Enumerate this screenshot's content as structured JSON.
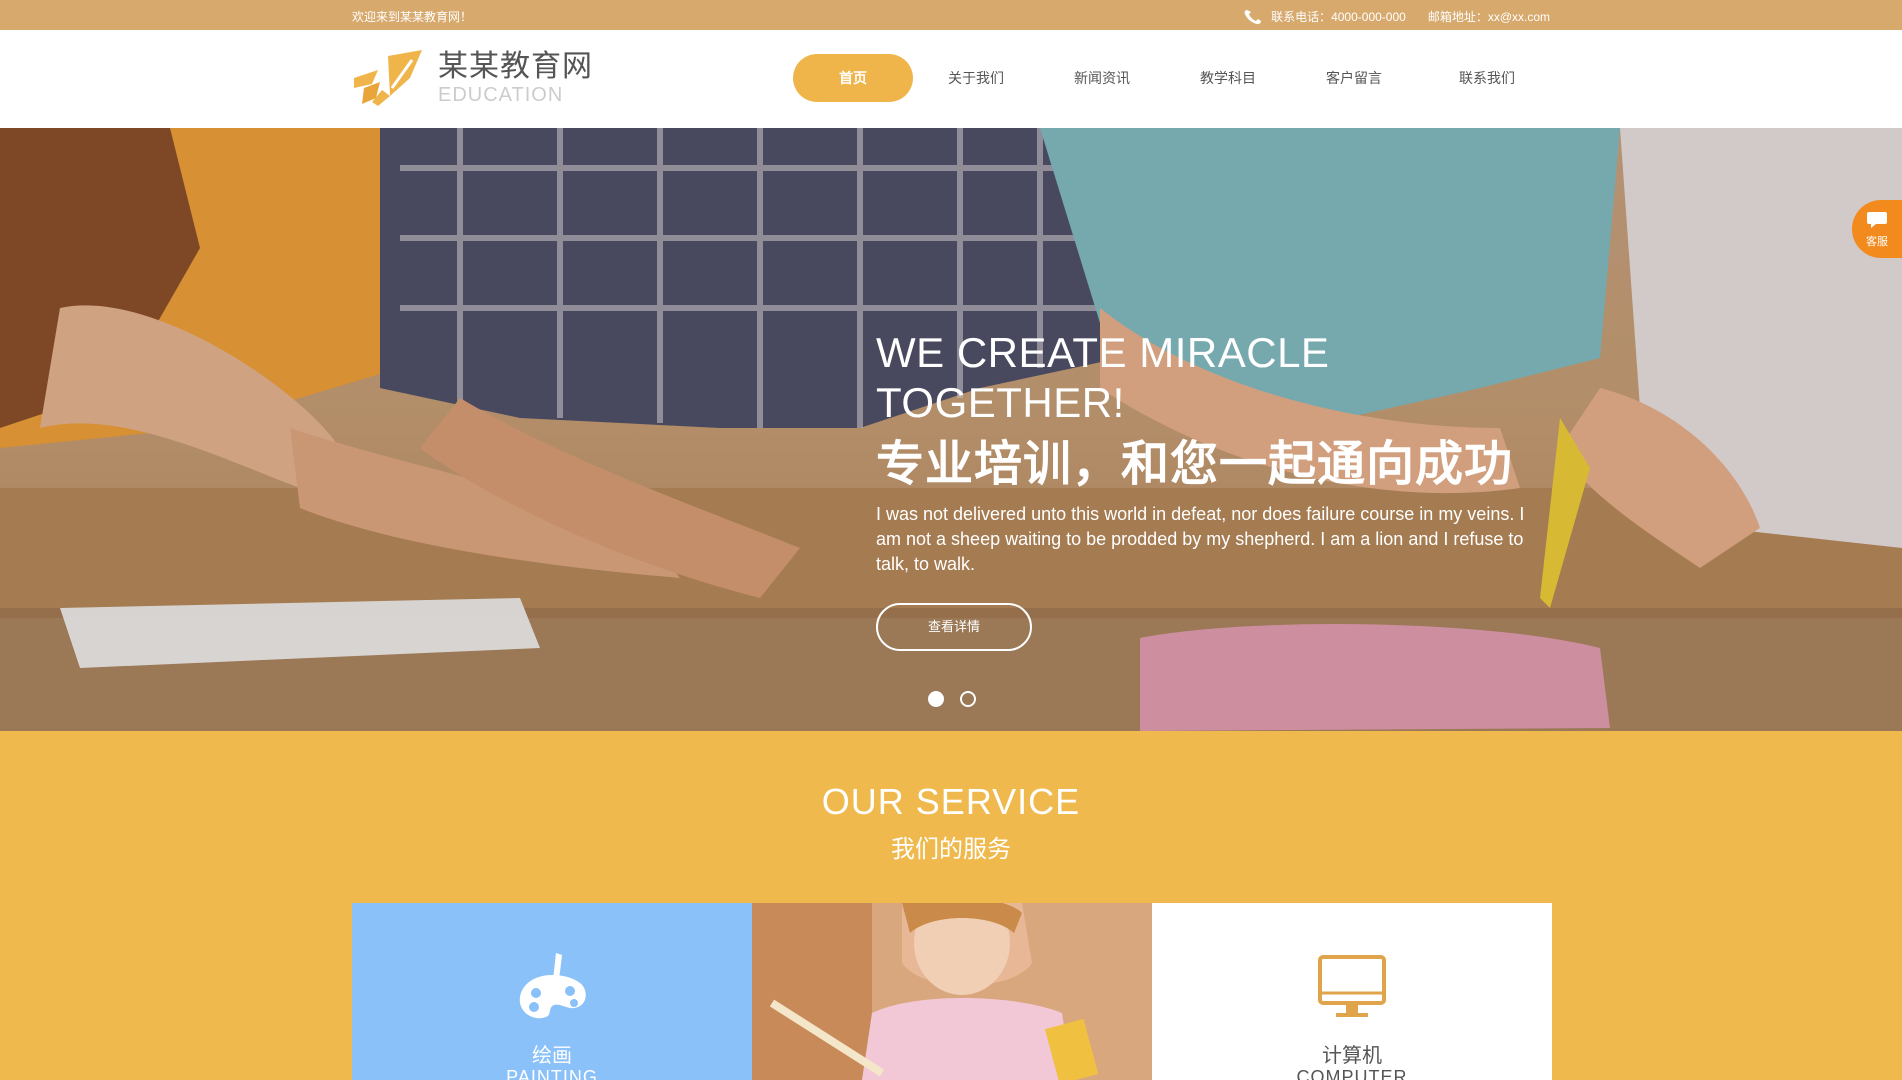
{
  "topbar": {
    "welcome": "欢迎来到某某教育网！",
    "phone": "联系电话：4000-000-000",
    "email": "邮箱地址：xx@xx.com"
  },
  "header": {
    "logo_name": "某某教育网",
    "logo_sub": "EDUCATION",
    "nav": [
      {
        "label": "首页",
        "active": true
      },
      {
        "label": "关于我们"
      },
      {
        "label": "新闻资讯"
      },
      {
        "label": "教学科目"
      },
      {
        "label": "客户留言"
      },
      {
        "label": "联系我们"
      }
    ]
  },
  "banner": {
    "heading_en": "WE CREATE MIRACLE TOGETHER!",
    "heading_cn": "专业培训，和您一起通向成功",
    "description": "I was not delivered unto this world in defeat, nor does failure course in my veins. I am not a sheep waiting to be prodded by my shepherd. I am a lion and I refuse to talk, to walk.",
    "button": "查看详情",
    "slides": 2,
    "active_slide": 1
  },
  "kefu": {
    "label": "客服"
  },
  "service": {
    "title": "OUR SERVICE",
    "subtitle": "我们的服务",
    "cards": [
      {
        "cn": "绘画",
        "en": "PAINTING",
        "icon": "palette-icon"
      },
      {
        "cn": "",
        "en": "",
        "icon": "child-drawing-photo"
      },
      {
        "cn": "计算机",
        "en": "COMPUTER",
        "icon": "monitor-icon"
      }
    ]
  },
  "colors": {
    "topbar": "#d7a96d",
    "accent": "#f0b54a",
    "service_bg": "#f0b94d",
    "painting_card": "#8ac1f9",
    "kefu": "#f28a1d"
  }
}
